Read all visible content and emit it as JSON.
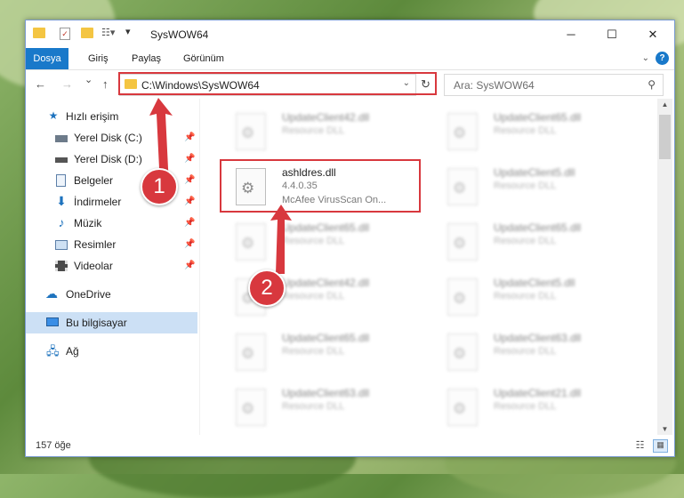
{
  "window": {
    "title": "SysWOW64",
    "minimize": "─",
    "maximize": "☐",
    "close": "✕"
  },
  "ribbon": {
    "tabs": [
      "Dosya",
      "Giriş",
      "Paylaş",
      "Görünüm"
    ],
    "help": "?"
  },
  "nav": {
    "back": "←",
    "forward": "→",
    "recent": "⌄",
    "up": "↑",
    "address": "C:\\Windows\\SysWOW64",
    "refresh": "↻",
    "search_placeholder": "Ara: SysWOW64"
  },
  "sidebar": {
    "quick_access": "Hızlı erişim",
    "items": [
      {
        "label": "Yerel Disk (C:)",
        "icon": "drive-icon"
      },
      {
        "label": "Yerel Disk (D:)",
        "icon": "drive-icon"
      },
      {
        "label": "Belgeler",
        "icon": "document-icon"
      },
      {
        "label": "İndirmeler",
        "icon": "download-icon"
      },
      {
        "label": "Müzik",
        "icon": "music-icon"
      },
      {
        "label": "Resimler",
        "icon": "picture-icon"
      },
      {
        "label": "Videolar",
        "icon": "video-icon"
      }
    ],
    "onedrive": "OneDrive",
    "this_pc": "Bu bilgisayar",
    "network": "Ağ"
  },
  "files": [
    {
      "name": "UpdateClient42.dll",
      "sub": "Resource DLL",
      "blurred": true
    },
    {
      "name": "UpdateClient65.dll",
      "sub": "Resource DLL",
      "blurred": true
    },
    {
      "name": "ashldres.dll",
      "sub": "4.4.0.35",
      "sub2": "McAfee VirusScan On...",
      "blurred": false
    },
    {
      "name": "UpdateClient5.dll",
      "sub": "Resource DLL",
      "blurred": true
    },
    {
      "name": "UpdateClient65.dll",
      "sub": "Resource DLL",
      "blurred": true
    },
    {
      "name": "UpdateClient65.dll",
      "sub": "Resource DLL",
      "blurred": true
    },
    {
      "name": "UpdateClient42.dll",
      "sub": "Resource DLL",
      "blurred": true
    },
    {
      "name": "UpdateClient5.dll",
      "sub": "Resource DLL",
      "blurred": true
    },
    {
      "name": "UpdateClient65.dll",
      "sub": "Resource DLL",
      "blurred": true
    },
    {
      "name": "UpdateClient63.dll",
      "sub": "Resource DLL",
      "blurred": true
    },
    {
      "name": "UpdateClient63.dll",
      "sub": "Resource DLL",
      "blurred": true
    },
    {
      "name": "UpdateClient21.dll",
      "sub": "Resource DLL",
      "blurred": true
    }
  ],
  "status": {
    "count": "157 öğe"
  },
  "annotations": {
    "badge1": "1",
    "badge2": "2",
    "color": "#d8383e"
  }
}
